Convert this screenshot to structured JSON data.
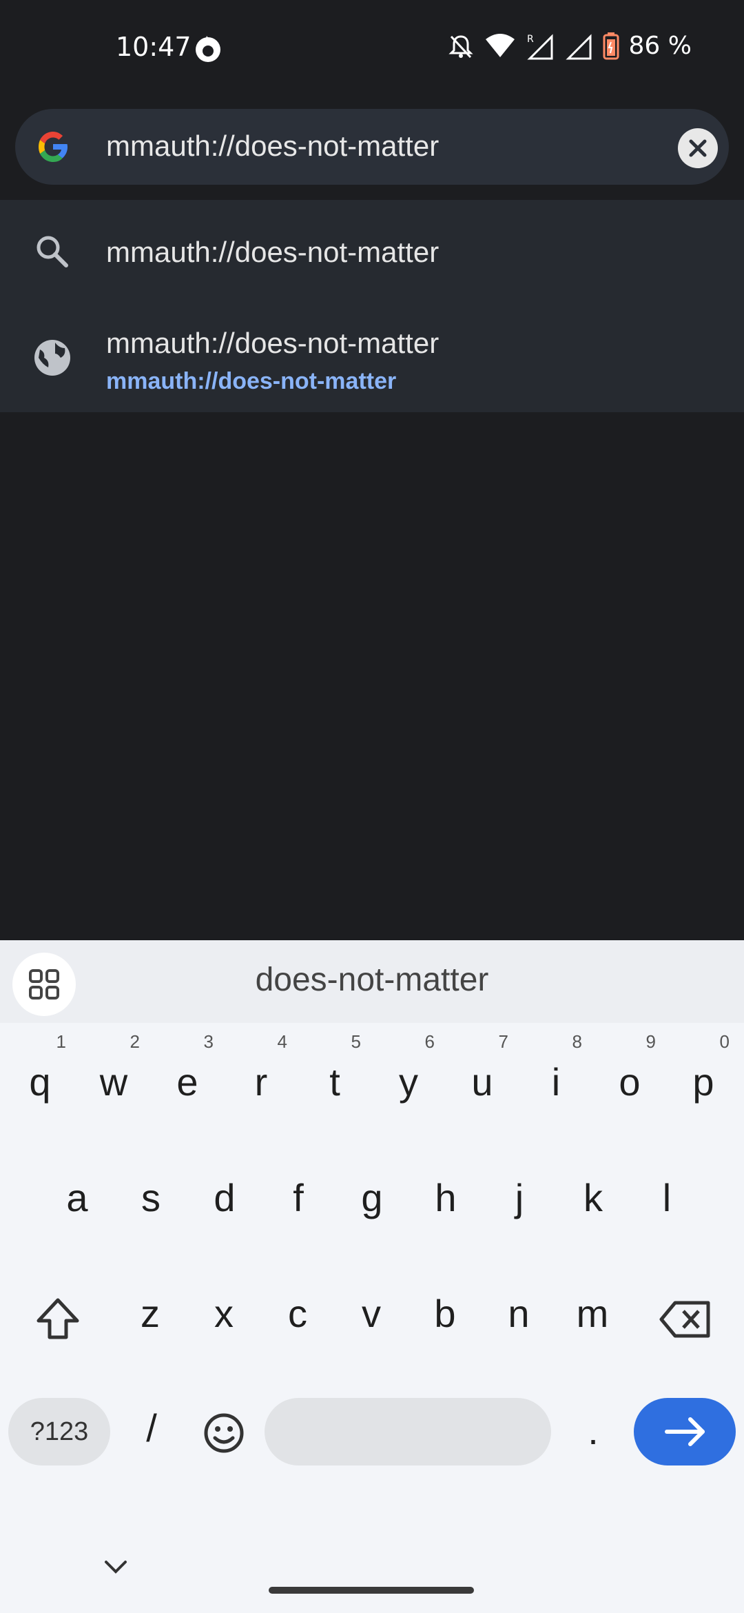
{
  "status_bar": {
    "time": "10:47",
    "battery_percent": "86 %"
  },
  "omnibox": {
    "url_text": "mmauth://does-not-matter"
  },
  "suggestions": [
    {
      "icon": "search-icon",
      "title": "mmauth://does-not-matter"
    },
    {
      "icon": "globe-icon",
      "title": "mmauth://does-not-matter",
      "url": "mmauth://does-not-matter"
    }
  ],
  "keyboard": {
    "suggestion": "does-not-matter",
    "row1": [
      {
        "key": "q",
        "num": "1"
      },
      {
        "key": "w",
        "num": "2"
      },
      {
        "key": "e",
        "num": "3"
      },
      {
        "key": "r",
        "num": "4"
      },
      {
        "key": "t",
        "num": "5"
      },
      {
        "key": "y",
        "num": "6"
      },
      {
        "key": "u",
        "num": "7"
      },
      {
        "key": "i",
        "num": "8"
      },
      {
        "key": "o",
        "num": "9"
      },
      {
        "key": "p",
        "num": "0"
      }
    ],
    "row2": [
      "a",
      "s",
      "d",
      "f",
      "g",
      "h",
      "j",
      "k",
      "l"
    ],
    "row3": [
      "z",
      "x",
      "c",
      "v",
      "b",
      "n",
      "m"
    ],
    "symbols_label": "?123",
    "slash_label": "/",
    "period_label": "."
  },
  "colors": {
    "background": "#1c1d20",
    "omnibox": "#2b3039",
    "suggestion_url": "#8ab4f8",
    "enter_key": "#2f6fe0"
  }
}
